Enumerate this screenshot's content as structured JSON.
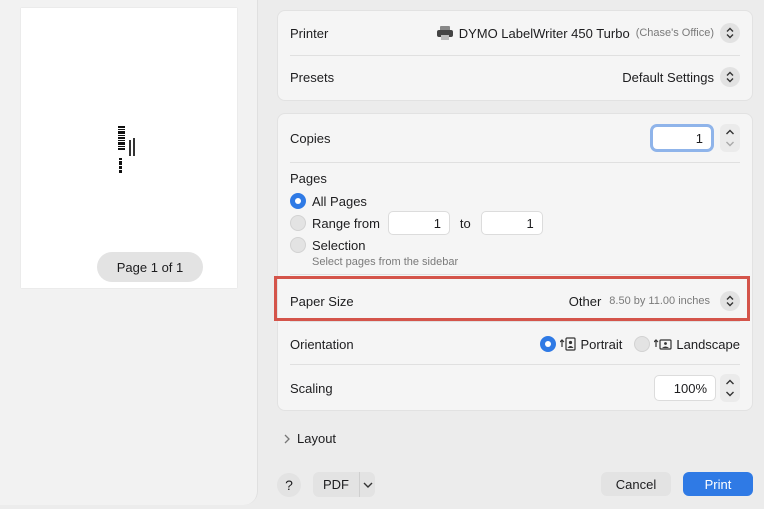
{
  "preview": {
    "page_indicator": "Page 1 of 1"
  },
  "printer": {
    "label": "Printer",
    "name": "DYMO LabelWriter 450 Turbo",
    "location": "(Chase's Office)",
    "icon": "printer-icon"
  },
  "presets": {
    "label": "Presets",
    "value": "Default Settings"
  },
  "copies": {
    "label": "Copies",
    "value": "1"
  },
  "pages": {
    "label": "Pages",
    "all_pages": "All Pages",
    "range_from": "Range from",
    "range_start": "1",
    "to": "to",
    "range_end": "1",
    "selection": "Selection",
    "selection_hint": "Select pages from the sidebar",
    "selected": "All Pages"
  },
  "paper_size": {
    "label": "Paper Size",
    "value": "Other",
    "detail": "8.50 by 11.00 inches"
  },
  "orientation": {
    "label": "Orientation",
    "portrait": "Portrait",
    "landscape": "Landscape",
    "selected": "Portrait"
  },
  "scaling": {
    "label": "Scaling",
    "value": "100%"
  },
  "layout": {
    "label": "Layout"
  },
  "footer": {
    "help": "?",
    "pdf": "PDF",
    "cancel": "Cancel",
    "print": "Print"
  },
  "colors": {
    "accent": "#2f7ae5",
    "highlight": "#d4544a"
  }
}
